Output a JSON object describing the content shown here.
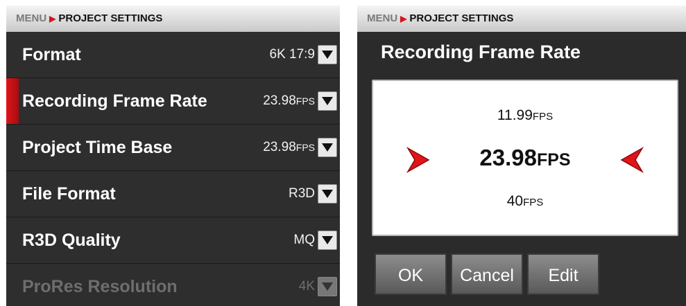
{
  "left_panel": {
    "breadcrumb": {
      "menu": "MENU",
      "page": "PROJECT SETTINGS"
    },
    "rows": [
      {
        "label": "Format",
        "value": "6K 17:9",
        "unit": ""
      },
      {
        "label": "Recording Frame Rate",
        "value": "23.98",
        "unit": "FPS"
      },
      {
        "label": "Project Time Base",
        "value": "23.98",
        "unit": "FPS"
      },
      {
        "label": "File Format",
        "value": "R3D",
        "unit": ""
      },
      {
        "label": "R3D Quality",
        "value": "MQ",
        "unit": ""
      },
      {
        "label": "ProRes Resolution",
        "value": "4K",
        "unit": ""
      }
    ]
  },
  "right_panel": {
    "breadcrumb": {
      "menu": "MENU",
      "page": "PROJECT SETTINGS"
    },
    "title": "Recording Frame Rate",
    "picker": {
      "previous": {
        "value": "11.99",
        "unit": "FPS"
      },
      "current": {
        "value": "23.98",
        "unit": "FPS"
      },
      "next": {
        "value": "40",
        "unit": "FPS"
      }
    },
    "buttons": {
      "ok": "OK",
      "cancel": "Cancel",
      "edit": "Edit"
    }
  },
  "colors": {
    "accent": "#d0151b",
    "panel": "#2b2b2b"
  }
}
